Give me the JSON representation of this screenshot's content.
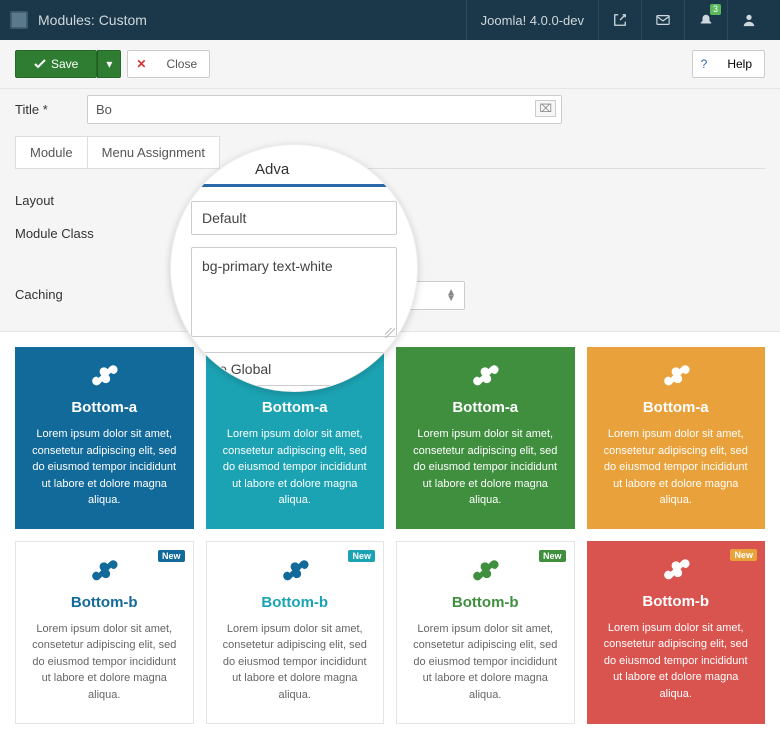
{
  "navbar": {
    "title": "Modules: Custom",
    "version": "Joomla! 4.0.0-dev",
    "notification_count": "3"
  },
  "toolbar": {
    "save_label": "Save",
    "close_label": "Close",
    "help_label": "Help"
  },
  "form": {
    "title_label": "Title *",
    "title_value": "Bo",
    "tabs": {
      "module": "Module",
      "menu_assignment": "Menu Assignment"
    },
    "layout_label": "Layout",
    "module_class_label": "Module Class",
    "caching_label": "Caching",
    "caching_value": "Us..."
  },
  "magnifier": {
    "tab_label": "Adva",
    "layout_value": "Default",
    "module_class_value": "bg-primary text-white",
    "caching_value": "Use Global"
  },
  "cards": {
    "top": [
      {
        "title": "Bottom-a",
        "text": "Lorem ipsum dolor sit amet, consetetur adipiscing elit, sed do eiusmod tempor incididunt ut labore et dolore magna aliqua."
      },
      {
        "title": "Bottom-a",
        "text": "Lorem ipsum dolor sit amet, consetetur adipiscing elit, sed do eiusmod tempor incididunt ut labore et dolore magna aliqua."
      },
      {
        "title": "Bottom-a",
        "text": "Lorem ipsum dolor sit amet, consetetur adipiscing elit, sed do eiusmod tempor incididunt ut labore et dolore magna aliqua."
      },
      {
        "title": "Bottom-a",
        "text": "Lorem ipsum dolor sit amet, consetetur adipiscing elit, sed do eiusmod tempor incididunt ut labore et dolore magna aliqua."
      }
    ],
    "bottom": [
      {
        "title": "Bottom-b",
        "badge": "New",
        "text": "Lorem ipsum dolor sit amet, consetetur adipiscing elit, sed do eiusmod tempor incididunt ut labore et dolore magna aliqua."
      },
      {
        "title": "Bottom-b",
        "badge": "New",
        "text": "Lorem ipsum dolor sit amet, consetetur adipiscing elit, sed do eiusmod tempor incididunt ut labore et dolore magna aliqua."
      },
      {
        "title": "Bottom-b",
        "badge": "New",
        "text": "Lorem ipsum dolor sit amet, consetetur adipiscing elit, sed do eiusmod tempor incididunt ut labore et dolore magna aliqua."
      },
      {
        "title": "Bottom-b",
        "badge": "New",
        "text": "Lorem ipsum dolor sit amet, consetetur adipiscing elit, sed do eiusmod tempor incididunt ut labore et dolore magna aliqua."
      }
    ]
  }
}
